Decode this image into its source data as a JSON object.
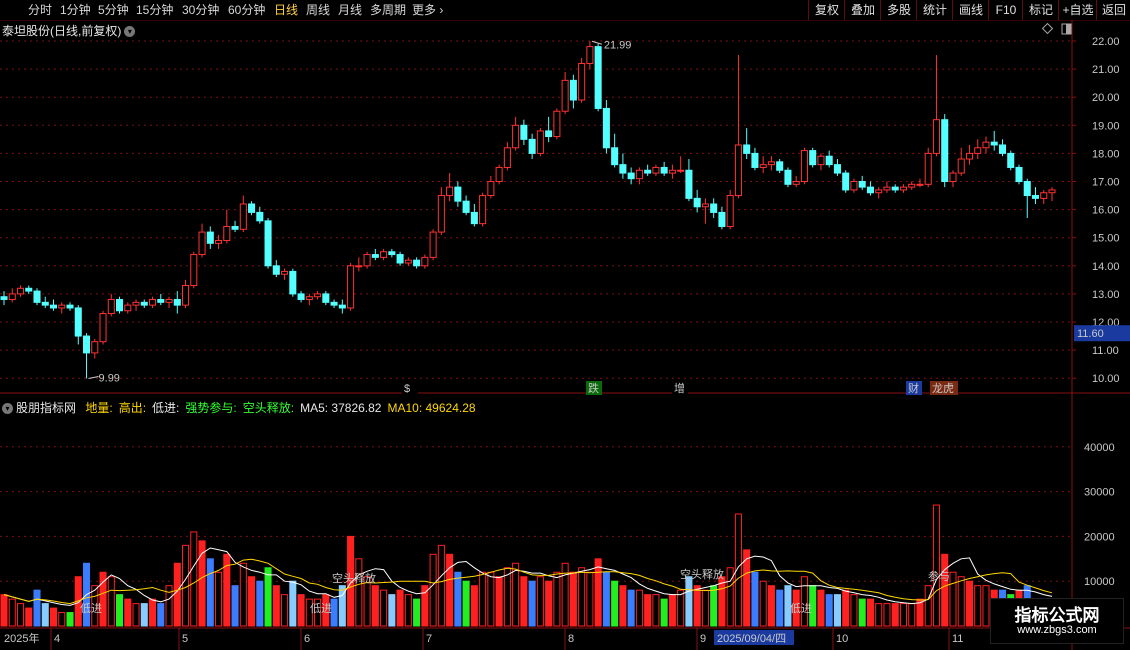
{
  "toolbar": {
    "periods": [
      "分时",
      "1分钟",
      "5分钟",
      "15分钟",
      "30分钟",
      "60分钟",
      "日线",
      "周线",
      "月线",
      "多周期",
      "更多"
    ],
    "active": "日线",
    "right_buttons": [
      "复权",
      "叠加",
      "多股",
      "统计",
      "画线",
      "F10",
      "标记",
      "+自选",
      "返回"
    ]
  },
  "stock": {
    "title": "泰坦股份(日线,前复权)"
  },
  "price_axis": {
    "labels": [
      "22.00",
      "21.00",
      "20.00",
      "19.00",
      "18.00",
      "17.00",
      "16.00",
      "15.00",
      "14.00",
      "13.00",
      "12.00",
      "11.00",
      "10.00"
    ],
    "current": "11.60",
    "high_label": "21.99",
    "low_label": "9.99"
  },
  "event_markers": [
    "$",
    "跌",
    "增",
    "财",
    "龙虎"
  ],
  "indicator": {
    "name": "股朋指标网",
    "items": [
      {
        "text": "地量:",
        "color": "#ffd700"
      },
      {
        "text": "高出:",
        "color": "#ffd700"
      },
      {
        "text": "低进:",
        "color": "#e8e8e8"
      },
      {
        "text": "强势参与:",
        "color": "#33ff33"
      },
      {
        "text": "空头释放:",
        "color": "#33ff33"
      },
      {
        "text": "MA5: 37826.82",
        "color": "#e8e8e8"
      },
      {
        "text": "MA10: 49624.28",
        "color": "#ffd700"
      }
    ]
  },
  "volume_axis": {
    "labels": [
      "40000",
      "30000",
      "20000",
      "10000"
    ]
  },
  "volume_annotations": [
    "空头释放",
    "空头释放",
    "参与",
    "低进",
    "低进",
    "低进"
  ],
  "date_axis": {
    "year": "2025年",
    "months": [
      "4",
      "5",
      "6",
      "7",
      "8",
      "9",
      "10",
      "11"
    ],
    "cursor_date": "2025/09/04/四"
  },
  "watermark": {
    "title": "指标公式网",
    "url": "www.zbgs3.com"
  },
  "colors": {
    "up": "#ff3232",
    "down": "#54ffff",
    "grid": "#7a1010",
    "ma5": "#ffffff",
    "ma10": "#ffd700"
  },
  "chart_data": {
    "type": "candlestick",
    "price_ylim": [
      10.0,
      22.0
    ],
    "volume_ylim": [
      0,
      40000
    ],
    "candles": [
      [
        12.9,
        13.1,
        12.6,
        12.8,
        7000
      ],
      [
        12.8,
        13.2,
        12.7,
        13.0,
        6000
      ],
      [
        13.0,
        13.3,
        12.9,
        13.2,
        5000
      ],
      [
        13.2,
        13.3,
        13.0,
        13.1,
        4000
      ],
      [
        13.1,
        13.2,
        12.6,
        12.7,
        8000
      ],
      [
        12.7,
        12.9,
        12.5,
        12.6,
        5000
      ],
      [
        12.6,
        12.8,
        12.4,
        12.5,
        4000
      ],
      [
        12.5,
        12.7,
        12.3,
        12.6,
        3000
      ],
      [
        12.6,
        12.7,
        12.4,
        12.5,
        3000
      ],
      [
        12.5,
        12.6,
        11.2,
        11.5,
        11000
      ],
      [
        11.5,
        11.6,
        9.99,
        10.9,
        14000
      ],
      [
        10.9,
        11.4,
        10.7,
        11.3,
        9000
      ],
      [
        11.3,
        12.4,
        11.2,
        12.3,
        12000
      ],
      [
        12.3,
        13.0,
        12.2,
        12.8,
        11000
      ],
      [
        12.8,
        12.9,
        12.3,
        12.4,
        7000
      ],
      [
        12.4,
        12.7,
        12.3,
        12.6,
        6000
      ],
      [
        12.6,
        12.8,
        12.4,
        12.7,
        5000
      ],
      [
        12.7,
        12.8,
        12.5,
        12.6,
        5000
      ],
      [
        12.6,
        12.9,
        12.5,
        12.8,
        6000
      ],
      [
        12.8,
        13.0,
        12.6,
        12.7,
        5000
      ],
      [
        12.7,
        12.9,
        12.5,
        12.8,
        9000
      ],
      [
        12.8,
        13.1,
        12.3,
        12.6,
        14000
      ],
      [
        12.6,
        13.5,
        12.5,
        13.3,
        18000
      ],
      [
        13.3,
        14.5,
        13.2,
        14.4,
        21000
      ],
      [
        14.4,
        15.5,
        14.3,
        15.2,
        19000
      ],
      [
        15.2,
        15.4,
        14.6,
        14.8,
        15000
      ],
      [
        14.8,
        15.1,
        14.6,
        14.9,
        12000
      ],
      [
        14.9,
        16.0,
        14.8,
        15.4,
        16000
      ],
      [
        15.4,
        15.6,
        15.2,
        15.3,
        9000
      ],
      [
        15.3,
        16.5,
        15.2,
        16.2,
        14000
      ],
      [
        16.2,
        16.3,
        15.8,
        15.9,
        11000
      ],
      [
        15.9,
        16.1,
        15.5,
        15.6,
        10000
      ],
      [
        15.6,
        15.7,
        13.9,
        14.0,
        13000
      ],
      [
        14.0,
        14.2,
        13.6,
        13.7,
        9000
      ],
      [
        13.7,
        13.9,
        13.5,
        13.8,
        7000
      ],
      [
        13.8,
        13.9,
        12.9,
        13.0,
        10000
      ],
      [
        13.0,
        13.1,
        12.7,
        12.8,
        7000
      ],
      [
        12.8,
        13.0,
        12.6,
        12.9,
        6000
      ],
      [
        12.9,
        13.1,
        12.8,
        13.0,
        6000
      ],
      [
        13.0,
        13.1,
        12.6,
        12.7,
        7000
      ],
      [
        12.7,
        12.8,
        12.5,
        12.6,
        6000
      ],
      [
        12.6,
        12.8,
        12.3,
        12.5,
        9000
      ],
      [
        12.5,
        14.1,
        12.4,
        14.0,
        20000
      ],
      [
        14.0,
        14.3,
        13.8,
        14.0,
        15000
      ],
      [
        14.0,
        14.5,
        13.9,
        14.4,
        11000
      ],
      [
        14.4,
        14.6,
        14.2,
        14.3,
        9000
      ],
      [
        14.3,
        14.6,
        14.2,
        14.5,
        8000
      ],
      [
        14.5,
        14.6,
        14.3,
        14.4,
        7000
      ],
      [
        14.4,
        14.5,
        14.0,
        14.1,
        8000
      ],
      [
        14.1,
        14.3,
        14.0,
        14.2,
        7000
      ],
      [
        14.2,
        14.3,
        13.9,
        14.0,
        6000
      ],
      [
        14.0,
        14.4,
        13.9,
        14.3,
        9000
      ],
      [
        14.3,
        15.3,
        14.2,
        15.2,
        16000
      ],
      [
        15.2,
        16.8,
        15.1,
        16.5,
        18000
      ],
      [
        16.5,
        17.3,
        16.3,
        16.8,
        16000
      ],
      [
        16.8,
        17.0,
        16.1,
        16.3,
        12000
      ],
      [
        16.3,
        16.5,
        15.8,
        15.9,
        10000
      ],
      [
        15.9,
        16.2,
        15.4,
        15.5,
        9000
      ],
      [
        15.5,
        16.6,
        15.4,
        16.5,
        12000
      ],
      [
        16.5,
        17.2,
        16.4,
        17.0,
        12000
      ],
      [
        17.0,
        17.6,
        16.9,
        17.5,
        11000
      ],
      [
        17.5,
        18.4,
        17.4,
        18.2,
        13000
      ],
      [
        18.2,
        19.3,
        18.1,
        19.0,
        14000
      ],
      [
        19.0,
        19.2,
        18.3,
        18.5,
        11000
      ],
      [
        18.5,
        18.7,
        17.8,
        18.0,
        10000
      ],
      [
        18.0,
        18.9,
        17.9,
        18.8,
        11000
      ],
      [
        18.8,
        19.3,
        18.4,
        18.6,
        10000
      ],
      [
        18.6,
        19.6,
        18.5,
        19.5,
        12000
      ],
      [
        19.5,
        20.9,
        19.4,
        20.6,
        14000
      ],
      [
        20.6,
        20.8,
        19.6,
        19.9,
        12000
      ],
      [
        19.9,
        21.4,
        19.8,
        21.2,
        13000
      ],
      [
        21.2,
        21.99,
        21.0,
        21.8,
        12000
      ],
      [
        21.8,
        21.9,
        19.5,
        19.6,
        15000
      ],
      [
        19.6,
        19.9,
        18.0,
        18.2,
        12000
      ],
      [
        18.2,
        18.7,
        17.5,
        17.6,
        10000
      ],
      [
        17.6,
        18.0,
        17.1,
        17.3,
        9000
      ],
      [
        17.3,
        17.5,
        16.9,
        17.1,
        8000
      ],
      [
        17.1,
        17.5,
        16.9,
        17.4,
        8000
      ],
      [
        17.4,
        17.6,
        17.2,
        17.3,
        7000
      ],
      [
        17.3,
        17.6,
        17.2,
        17.5,
        7000
      ],
      [
        17.5,
        17.7,
        17.2,
        17.3,
        6000
      ],
      [
        17.3,
        17.6,
        17.1,
        17.4,
        7000
      ],
      [
        17.4,
        17.9,
        17.3,
        17.4,
        8000
      ],
      [
        17.4,
        17.8,
        16.3,
        16.4,
        11000
      ],
      [
        16.4,
        16.7,
        15.9,
        16.1,
        9000
      ],
      [
        16.1,
        16.4,
        15.5,
        16.2,
        8000
      ],
      [
        16.2,
        16.4,
        15.7,
        15.9,
        9000
      ],
      [
        15.9,
        16.1,
        15.3,
        15.4,
        11000
      ],
      [
        15.4,
        16.7,
        15.3,
        16.5,
        13000
      ],
      [
        16.5,
        21.5,
        16.4,
        18.3,
        25000
      ],
      [
        18.3,
        18.9,
        17.8,
        18.0,
        17000
      ],
      [
        18.0,
        18.2,
        17.4,
        17.5,
        12000
      ],
      [
        17.5,
        17.9,
        17.3,
        17.6,
        10000
      ],
      [
        17.6,
        17.9,
        17.4,
        17.7,
        9000
      ],
      [
        17.7,
        17.8,
        17.3,
        17.4,
        8000
      ],
      [
        17.4,
        17.5,
        16.8,
        16.9,
        9000
      ],
      [
        16.9,
        17.2,
        16.8,
        17.0,
        8000
      ],
      [
        17.0,
        18.2,
        16.9,
        18.1,
        11000
      ],
      [
        18.1,
        18.2,
        17.5,
        17.6,
        9000
      ],
      [
        17.6,
        18.0,
        17.4,
        17.9,
        8000
      ],
      [
        17.9,
        18.1,
        17.5,
        17.6,
        7000
      ],
      [
        17.6,
        17.8,
        17.2,
        17.3,
        7000
      ],
      [
        17.3,
        17.4,
        16.6,
        16.7,
        8000
      ],
      [
        16.7,
        17.1,
        16.6,
        17.0,
        7000
      ],
      [
        17.0,
        17.2,
        16.7,
        16.8,
        6000
      ],
      [
        16.8,
        17.0,
        16.5,
        16.6,
        6000
      ],
      [
        16.6,
        16.8,
        16.4,
        16.7,
        5000
      ],
      [
        16.7,
        17.0,
        16.6,
        16.8,
        5000
      ],
      [
        16.8,
        16.9,
        16.6,
        16.7,
        5000
      ],
      [
        16.7,
        16.9,
        16.6,
        16.8,
        5000
      ],
      [
        16.8,
        17.0,
        16.7,
        16.9,
        5000
      ],
      [
        16.9,
        17.1,
        16.8,
        16.9,
        6000
      ],
      [
        16.9,
        18.2,
        16.8,
        18.0,
        9000
      ],
      [
        18.0,
        21.5,
        17.9,
        19.2,
        27000
      ],
      [
        19.2,
        19.4,
        16.8,
        17.0,
        16000
      ],
      [
        17.0,
        17.4,
        16.8,
        17.3,
        12000
      ],
      [
        17.3,
        18.2,
        17.2,
        17.8,
        11000
      ],
      [
        17.8,
        18.3,
        17.6,
        18.0,
        10000
      ],
      [
        18.0,
        18.5,
        17.8,
        18.2,
        9000
      ],
      [
        18.2,
        18.6,
        18.0,
        18.4,
        9000
      ],
      [
        18.4,
        18.8,
        18.1,
        18.3,
        8000
      ],
      [
        18.3,
        18.5,
        17.9,
        18.0,
        8000
      ],
      [
        18.0,
        18.1,
        17.4,
        17.5,
        7000
      ],
      [
        17.5,
        17.6,
        16.9,
        17.0,
        8000
      ],
      [
        17.0,
        17.1,
        15.7,
        16.5,
        9000
      ],
      [
        16.5,
        16.8,
        16.2,
        16.4,
        6000
      ],
      [
        16.4,
        16.7,
        16.2,
        16.6,
        5000
      ],
      [
        16.6,
        16.8,
        16.3,
        16.7,
        5000
      ]
    ]
  }
}
